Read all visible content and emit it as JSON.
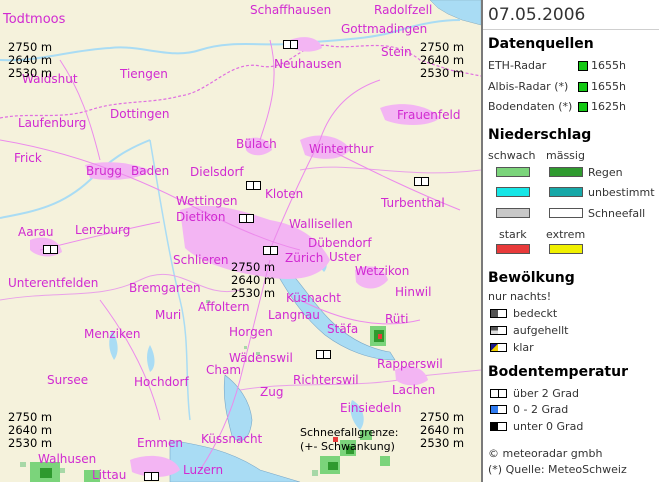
{
  "date": "07.05.2006",
  "sources": {
    "title": "Datenquellen",
    "items": [
      {
        "label": "ETH-Radar",
        "time": "1655h"
      },
      {
        "label": "Albis-Radar (*)",
        "time": "1655h"
      },
      {
        "label": "Bodendaten (*)",
        "time": "1625h"
      }
    ]
  },
  "precip": {
    "title": "Niederschlag",
    "col_weak": "schwach",
    "col_medium": "mässig",
    "rain": "Regen",
    "undetermined": "unbestimmt",
    "snow": "Schneefall",
    "strong": "stark",
    "extreme": "extrem",
    "colors": {
      "rain_weak": "#7bd47b",
      "rain_medium": "#2f9a2f",
      "undet_weak": "#16e6e6",
      "undet_medium": "#16a8a8",
      "snow_weak": "#c8c8c8",
      "snow_medium": "#ffffff",
      "strong": "#e83a3a",
      "extreme": "#f0f000"
    }
  },
  "clouds": {
    "title": "Bewölkung",
    "note": "nur nachts!",
    "items": [
      "bedeckt",
      "aufgehellt",
      "klar"
    ]
  },
  "ground_temp": {
    "title": "Bodentemperatur",
    "items": [
      "über 2 Grad",
      "0 - 2 Grad",
      "unter 0 Grad"
    ]
  },
  "credits": {
    "copyright": "© meteoradar gmbh",
    "source": "(*) Quelle: MeteoSchweiz"
  },
  "map": {
    "altitudes": [
      "2750 m",
      "2640 m",
      "2530 m"
    ],
    "snowline_label": "Schneefallgrenze:",
    "snowline_note": "(+- Schwankung)",
    "cities": [
      "Todtmoos",
      "Schaffhausen",
      "Radolfzell",
      "Gottmadingen",
      "Stein",
      "Neuhausen",
      "Waldshut",
      "Tiengen",
      "Laufenburg",
      "Dottingen",
      "Frauenfeld",
      "Frick",
      "Brugg",
      "Baden",
      "Dielsdorf",
      "Bülach",
      "Winterthur",
      "Wettingen",
      "Kloten",
      "Dietikon",
      "Turbenthal",
      "Aarau",
      "Lenzburg",
      "Wallisellen",
      "Dübendorf",
      "Zürich",
      "Uster",
      "Schlieren",
      "Unterentfelden",
      "Bremgarten",
      "Wetzikon",
      "Küsnacht",
      "Hinwil",
      "Affoltern",
      "Muri",
      "Langnau",
      "Menziken",
      "Horgen",
      "Stäfa",
      "Rüti",
      "Wädenswil",
      "Cham",
      "Rapperswil",
      "Sursee",
      "Hochdorf",
      "Richterswil",
      "Zug",
      "Lachen",
      "Einsiedeln",
      "Emmen",
      "Küssnacht",
      "Walhusen",
      "Littau",
      "Luzern"
    ]
  }
}
